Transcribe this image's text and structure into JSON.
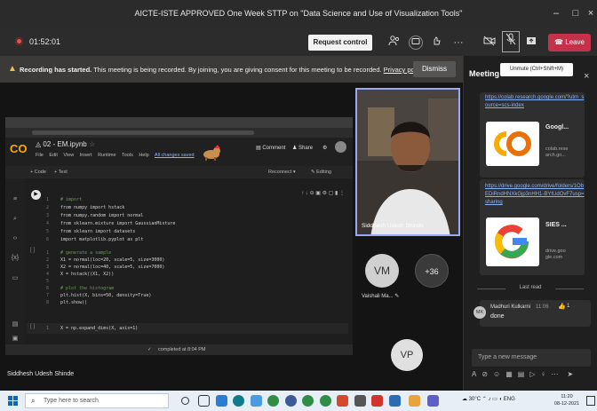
{
  "window": {
    "title": "AICTE-ISTE APPROVED One Week STTP on \"Data Science and Use of Visualization Tools\"",
    "minimize": "–",
    "maximize": "□",
    "close": "×"
  },
  "toolbar": {
    "timer": "01:52:01",
    "request_control": "Request control",
    "leave": "Leave",
    "more": "···"
  },
  "banner": {
    "bold": "Recording has started.",
    "text": " This meeting is being recorded. By joining, you are giving consent for this meeting to be recorded.",
    "privacy": "Privacy policy",
    "dismiss": "Dismiss"
  },
  "notebook": {
    "title": "02 - EM.ipynb",
    "menu": [
      "File",
      "Edit",
      "View",
      "Insert",
      "Runtime",
      "Tools",
      "Help"
    ],
    "saved": "All changes saved",
    "comment": "Comment",
    "share": "Share",
    "add_code": "+ Code",
    "add_text": "+ Text",
    "reconnect": "Reconnect",
    "editing": "Editing",
    "status": "completed at 8:04 PM",
    "cell1": [
      {
        "ln": "1",
        "code": "# import"
      },
      {
        "ln": "2",
        "code": "from numpy import hstack"
      },
      {
        "ln": "3",
        "code": "from numpy.random import normal"
      },
      {
        "ln": "4",
        "code": "from sklearn.mixture import GaussianMixture"
      },
      {
        "ln": "5",
        "code": "from sklearn import datasets"
      },
      {
        "ln": "6",
        "code": "import matplotlib.pyplot as plt"
      }
    ],
    "cell2": [
      {
        "ln": "1",
        "code": "# generate a sample"
      },
      {
        "ln": "2",
        "code": "X1 = normal(loc=20, scale=5, size=3000)"
      },
      {
        "ln": "3",
        "code": "X2 = normal(loc=40, scale=5, size=7000)"
      },
      {
        "ln": "4",
        "code": "X = hstack((X1, X2))"
      },
      {
        "ln": "5",
        "code": ""
      },
      {
        "ln": "6",
        "code": "# plot the histogram"
      },
      {
        "ln": "7",
        "code": "plt.hist(X, bins=50, density=True)"
      },
      {
        "ln": "8",
        "code": "plt.show()"
      }
    ],
    "cell3": {
      "ln": "1",
      "code": "X = np.expand_dims(X, axis=1)"
    },
    "cell_brackets": "[ ]"
  },
  "presenter_name": "Siddhesh Udesh Shinde",
  "participants": {
    "video_name": "Siddhesh Udesh Shinde",
    "vm_initials": "VM",
    "vm_name": "Vaishali Ma...",
    "more_count": "+36",
    "vp_initials": "VP"
  },
  "panel": {
    "title": "Meeting",
    "tooltip": "Unmute (Ctrl+Shift+M)",
    "link1": "https://colab.research.google.com/?utm_source=scs-index",
    "card1_title": "Googl...",
    "card1_sub": "colab.rese arch.go...",
    "link2": "https://drive.google.com/drive/folders/1ObEDiRndHNXkGjp3nHH1-BYtUdOvF7usp=sharing",
    "card2_title": "SIES ...",
    "card2_sub": "drive.goo gle.com",
    "last_read": "Last read",
    "msg_sender": "Madhuri Kulkarni",
    "msg_time": "11:06",
    "msg_text": "done",
    "msg_initials": "MK",
    "like_count": "1",
    "compose_placeholder": "Type a new message"
  },
  "taskbar": {
    "search_placeholder": "Type here to search",
    "weather": "30°C",
    "lang": "ENG",
    "time": "11:20",
    "date": "08-12-2021"
  },
  "colors": {
    "leave": "#c4314b",
    "video_border": "#9ba8f5",
    "link": "#8ab4f8",
    "colab_orange": "#f9ab00"
  }
}
